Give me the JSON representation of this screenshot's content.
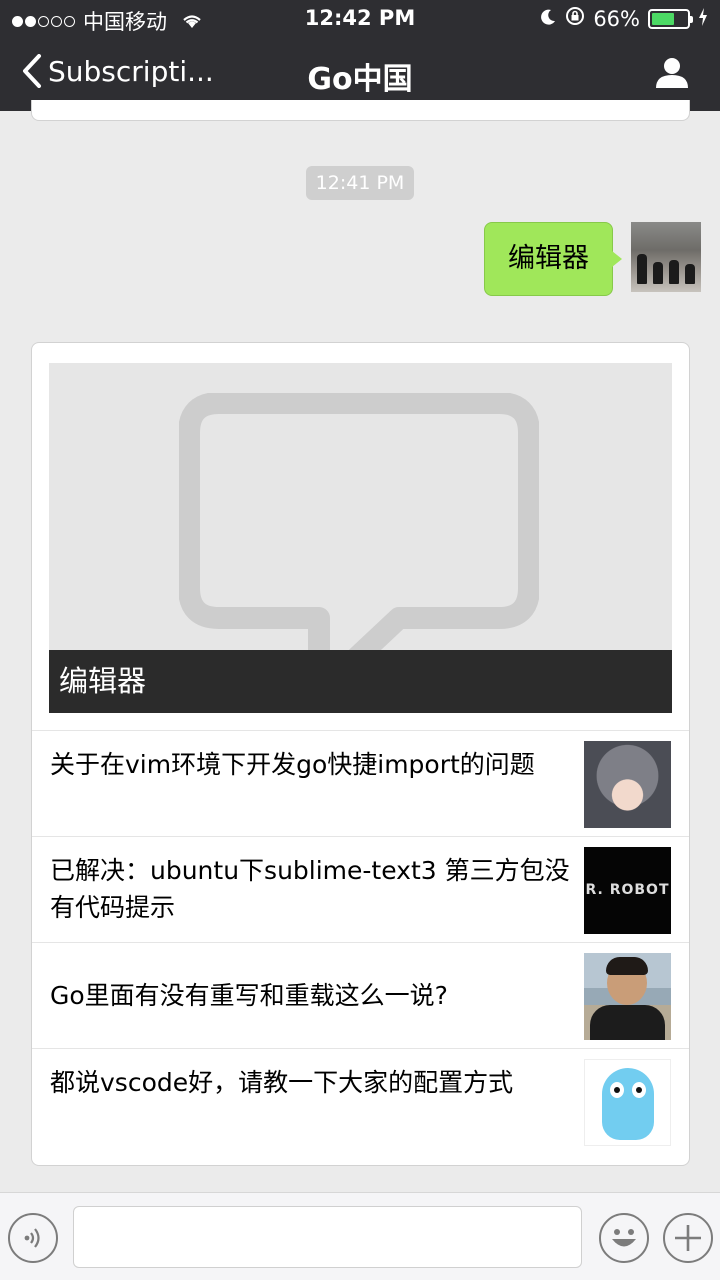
{
  "status_bar": {
    "carrier": "中国移动",
    "time": "12:42 PM",
    "battery_percent": "66%",
    "battery_level": 0.66
  },
  "nav": {
    "back_label": "Subscripti...",
    "title": "Go中国"
  },
  "chat": {
    "timestamp": "12:41 PM",
    "sent_message": "编辑器"
  },
  "article_card": {
    "cover_title": "编辑器",
    "items": [
      {
        "title": "关于在vim环境下开发go快捷import的问题"
      },
      {
        "title": "已解决：ubuntu下sublime-text3 第三方包没有代码提示",
        "thumb_text": "R. ROBOT"
      },
      {
        "title": "Go里面有没有重写和重载这么一说?"
      },
      {
        "title": "都说vscode好，请教一下大家的配置方式"
      }
    ]
  },
  "colors": {
    "nav_bg": "#2e2e32",
    "bubble_green": "#a0e75a",
    "battery_green": "#4cd964"
  }
}
